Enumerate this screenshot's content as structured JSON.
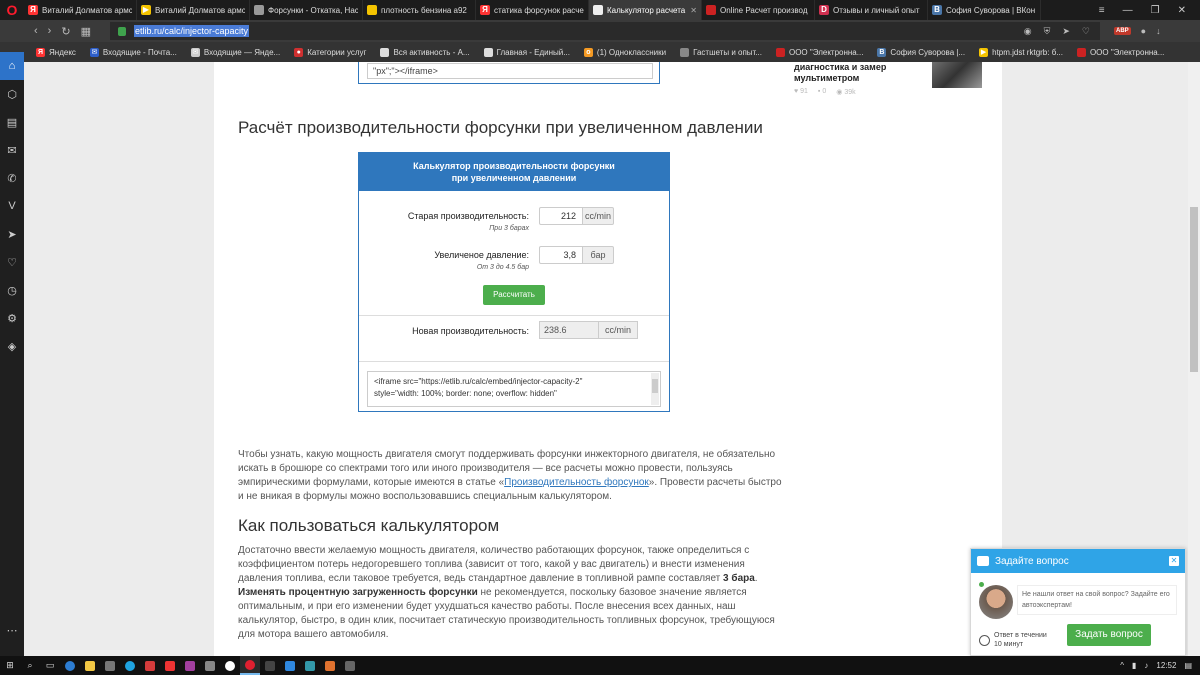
{
  "tabs": [
    {
      "label": "Виталий Долматов армс",
      "icon": "yandex-icon",
      "color": "#ff3333",
      "glyph": "Я",
      "active": false
    },
    {
      "label": "Виталий Долматов армс",
      "icon": "play-icon",
      "color": "#f5c400",
      "glyph": "▶",
      "active": false
    },
    {
      "label": "Форсунки - Откатка, Нас",
      "icon": "page-icon",
      "color": "#999999",
      "glyph": "",
      "active": false
    },
    {
      "label": "плотность бензина а92",
      "icon": "bookmark-icon",
      "color": "#f5c400",
      "glyph": "",
      "active": false
    },
    {
      "label": "статика форсунок расче",
      "icon": "yandex-icon",
      "color": "#ff3333",
      "glyph": "Я",
      "active": false
    },
    {
      "label": "Калькулятор расчета пр",
      "icon": "calc-icon",
      "color": "#eeeeee",
      "glyph": "",
      "active": true
    },
    {
      "label": "Online Расчет производ",
      "icon": "drive2-icon",
      "color": "#cc2222",
      "glyph": "",
      "active": false
    },
    {
      "label": "Отзывы и личный опыт",
      "icon": "d-icon",
      "color": "#d03050",
      "glyph": "D",
      "active": false
    },
    {
      "label": "София Суворова | ВКон",
      "icon": "vk-icon",
      "color": "#4a76a8",
      "glyph": "В",
      "active": false
    }
  ],
  "address": {
    "url": "etlib.ru/calc/injector-capacity"
  },
  "bookmarks": [
    {
      "label": "Яндекс",
      "color": "#ff3333",
      "glyph": "Я"
    },
    {
      "label": "Входящие - Почта...",
      "color": "#2d5ec9",
      "glyph": "✉"
    },
    {
      "label": "Входящие — Янде...",
      "color": "#cccccc",
      "glyph": "✉"
    },
    {
      "label": "Категории услуг",
      "color": "#d03030",
      "glyph": "●"
    },
    {
      "label": "Вся активность - А...",
      "color": "#dddddd",
      "glyph": ""
    },
    {
      "label": "Главная - Единый...",
      "color": "#dddddd",
      "glyph": ""
    },
    {
      "label": "(1) Одноклассники",
      "color": "#f59a23",
      "glyph": "о"
    },
    {
      "label": "Гастшеты и опыт...",
      "color": "#888888",
      "glyph": ""
    },
    {
      "label": "ООО \"Электронна...",
      "color": "#cc2222",
      "glyph": ""
    },
    {
      "label": "София Суворова |...",
      "color": "#4a76a8",
      "glyph": "В"
    },
    {
      "label": "htpm.jdst rktgrb: б...",
      "color": "#f5c400",
      "glyph": "▶"
    },
    {
      "label": "ООО \"Электронна...",
      "color": "#cc2222",
      "glyph": ""
    }
  ],
  "sidebar": [
    "home-icon",
    "cube-icon",
    "newspaper-icon",
    "messenger-icon",
    "whatsapp-icon",
    "vk-icon",
    "send-icon",
    "heart-icon",
    "history-icon",
    "settings-icon",
    "extension-icon"
  ],
  "prev_iframe": {
    "code": "\"px\";\"></iframe>"
  },
  "right_article": {
    "title": "диагностика и замер мультиметром",
    "likes": "91",
    "comments": "0",
    "views": "39k"
  },
  "heading1": "Расчёт производительности форсунки при увеличенном давлении",
  "calc": {
    "title_line1": "Калькулятор производительности форсунки",
    "title_line2": "при увеличенном давлении",
    "old_label": "Старая производительность:",
    "old_sub": "При 3 барах",
    "old_value": "212",
    "old_unit": "cc/min",
    "pressure_label": "Увеличеное давление:",
    "pressure_sub": "От 3 до 4.5 бар",
    "pressure_value": "3,8",
    "pressure_unit": "бар",
    "button": "Рассчитать",
    "result_label": "Новая производительность:",
    "result_value": "238.6",
    "result_unit": "cc/min",
    "embed_line1": "<iframe src=\"https://etlib.ru/calc/embed/injector-capacity-2\"",
    "embed_line2": "style=\"width: 100%; border: none; overflow: hidden\""
  },
  "para1": {
    "before": "Чтобы узнать, какую мощность двигателя смогут поддерживать форсунки инжекторного двигателя, не обязательно искать в брошюре со спектрами того или иного производителя — все расчеты можно провести, пользуясь эмпирическими формулами, которые имеются в статье «",
    "link": "Производительность форсунок",
    "after": "». Провести расчеты быстро и не вникая в формулы можно воспользовавшись специальным калькулятором."
  },
  "heading2": "Как пользоваться калькулятором",
  "para2": {
    "part1": "Достаточно ввести желаемую мощность двигателя, количество работающих форсунок, также определиться с коэффициентом потерь недогоревшего топлива (зависит от того, какой у вас двигатель) и внести изменения давления топлива, если таковое требуется, ведь стандартное давление в топливной рампе составляет ",
    "bold1": "3 бара",
    "part2": ". ",
    "bold2": "Изменять процентную загруженность форсунки",
    "part3": " не рекомендуется, поскольку базовое значение является оптимальным, и при его изменении будет ухудшаться качество работы. После внесения всех данных, наш калькулятор, быстро, в один клик, посчитает статическую производительность топливных форсунок, требующуюся для мотора вашего автомобиля."
  },
  "chat": {
    "header": "Задайте вопрос",
    "message": "Не нашли ответ на свой вопрос? Задайте его автоэкспертам!",
    "timer_line1": "Ответ в течении",
    "timer_line2": "10 минут",
    "button": "Задать вопрос"
  },
  "taskbar": {
    "time": "12:52"
  }
}
